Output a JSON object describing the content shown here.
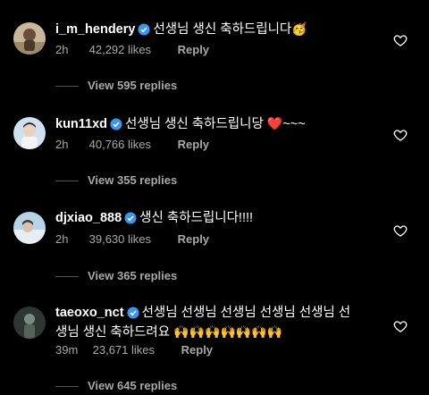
{
  "comments": [
    {
      "username": "i_m_hendery",
      "text": "선생님 생신 축하드립니다",
      "emoji": "🥳",
      "time": "2h",
      "likes": "42,292 likes",
      "reply_label": "Reply",
      "view_replies": "View 595 replies"
    },
    {
      "username": "kun11xd",
      "text": "선생님 생신 축하드립니당",
      "emoji": "❤️",
      "suffix": "~~~",
      "time": "2h",
      "likes": "40,766 likes",
      "reply_label": "Reply",
      "view_replies": "View 355 replies"
    },
    {
      "username": "djxiao_888",
      "text": "생신 축하드립니다!!!!",
      "time": "2h",
      "likes": "39,630 likes",
      "reply_label": "Reply",
      "view_replies": "View 365 replies"
    },
    {
      "username": "taeoxo_nct",
      "text": "선생님 선생님 선생님 선생님 선생님 선",
      "text_line2": "생님 생신 축하드려요",
      "emoji": "🙌🙌🙌🙌🙌🙌🙌",
      "time": "39m",
      "likes": "23,671 likes",
      "reply_label": "Reply",
      "view_replies": "View 645 replies"
    }
  ],
  "colors": {
    "background": "#000000",
    "text": "#ffffff",
    "muted": "#a8a8a8",
    "verified": "#3897f0"
  },
  "icons": {
    "verified": "verified-badge-icon",
    "like": "heart-outline-icon"
  }
}
